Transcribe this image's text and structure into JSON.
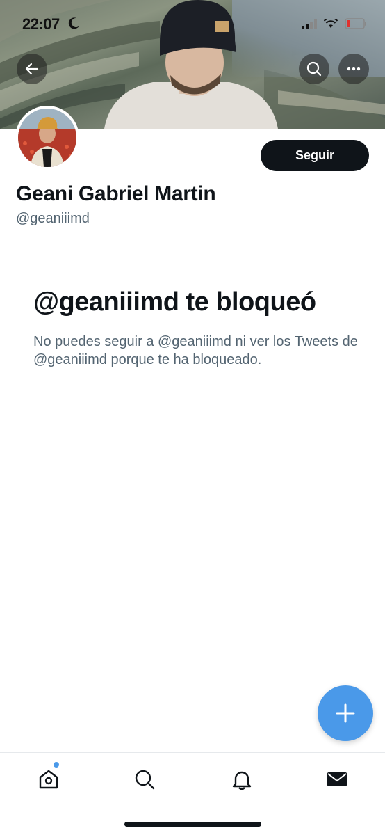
{
  "status_bar": {
    "time": "22:07"
  },
  "profile": {
    "display_name": "Geani Gabriel Martin",
    "handle": "@geaniiimd",
    "follow_label": "Seguir"
  },
  "blocked": {
    "title": "@geaniiimd te bloqueó",
    "description": "No puedes seguir a @geaniiimd ni ver los Tweets de @geaniiimd porque te ha bloqueado."
  },
  "icons": {
    "back": "arrow-left-icon",
    "search": "search-icon",
    "more": "more-horizontal-icon",
    "compose": "plus-icon",
    "home": "home-icon",
    "explore": "search-icon",
    "notifications": "bell-icon",
    "messages": "mail-icon"
  },
  "colors": {
    "accent": "#4a99e9",
    "text_primary": "#0f1419",
    "text_secondary": "#536471",
    "follow_button_bg": "#0f1419"
  },
  "tab_bar": {
    "active_tab": "home",
    "home_has_notification_dot": true
  }
}
